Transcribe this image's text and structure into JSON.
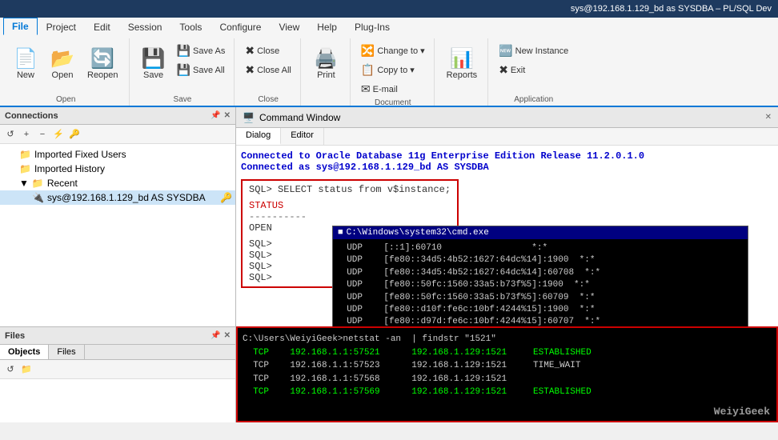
{
  "titleBar": {
    "text": "sys@192.168.1.129_bd as SYSDBA – PL/SQL Dev"
  },
  "menu": {
    "items": [
      "File",
      "Project",
      "Edit",
      "Session",
      "Tools",
      "Configure",
      "View",
      "Help",
      "Plug-Ins"
    ]
  },
  "ribbon": {
    "groups": [
      {
        "label": "Open",
        "buttons": [
          {
            "id": "new",
            "label": "New",
            "icon": "📄"
          },
          {
            "id": "open",
            "label": "Open",
            "icon": "📂"
          },
          {
            "id": "reopen",
            "label": "Reopen",
            "icon": "🔄"
          }
        ]
      },
      {
        "label": "Save",
        "buttons": [
          {
            "id": "save",
            "label": "Save",
            "icon": "💾"
          },
          {
            "id": "save-as",
            "label": "Save As",
            "icon": "💾"
          },
          {
            "id": "save-all",
            "label": "Save All",
            "icon": "💾"
          }
        ]
      },
      {
        "label": "Close",
        "buttons": [
          {
            "id": "close",
            "label": "Close",
            "icon": "✖"
          },
          {
            "id": "close-all",
            "label": "Close All",
            "icon": "✖"
          }
        ]
      },
      {
        "label": "",
        "buttons": [
          {
            "id": "print",
            "label": "Print",
            "icon": "🖨️"
          }
        ]
      },
      {
        "label": "Document",
        "buttons": [
          {
            "id": "change-to",
            "label": "Change to ▾",
            "icon": "🔀"
          },
          {
            "id": "copy-to",
            "label": "Copy to ▾",
            "icon": "📋"
          },
          {
            "id": "email",
            "label": "E-mail",
            "icon": "✉"
          }
        ]
      },
      {
        "label": "",
        "buttons": [
          {
            "id": "reports",
            "label": "Reports",
            "icon": "📊"
          }
        ]
      },
      {
        "label": "Application",
        "buttons": [
          {
            "id": "new-instance",
            "label": "New Instance",
            "icon": "🆕"
          },
          {
            "id": "exit",
            "label": "Exit",
            "icon": "🚪"
          }
        ]
      }
    ]
  },
  "tabRibbon": {
    "activeTab": "File",
    "tabs": [
      "File",
      "Project",
      "Edit",
      "Session",
      "Tools",
      "Configure",
      "View",
      "Help",
      "Plug-Ins"
    ]
  },
  "connections": {
    "title": "Connections",
    "tree": [
      {
        "label": "Imported Fixed Users",
        "level": 1,
        "icon": "📁"
      },
      {
        "label": "Imported History",
        "level": 1,
        "icon": "📁"
      },
      {
        "label": "Recent",
        "level": 1,
        "icon": "📁",
        "expanded": true
      },
      {
        "label": "sys@192.168.1.129_bd AS SYSDBA",
        "level": 2,
        "icon": "🔌",
        "selected": true
      }
    ]
  },
  "bottomPanel": {
    "tabs": [
      "Objects",
      "Files"
    ],
    "activeTab": "Objects"
  },
  "commandWindow": {
    "title": "Command Window",
    "tabs": [
      "Dialog",
      "Editor"
    ],
    "activeTab": "Dialog",
    "connectedLine1": "Connected to Oracle Database 11g Enterprise Edition Release 11.2.0.1.0",
    "connectedLine2": "Connected as sys@192.168.1.129_bd AS SYSDBA",
    "sqlQuery": "SQL> SELECT status from v$instance;",
    "statusLabel": "STATUS",
    "dashes": "----------",
    "openValue": "OPEN",
    "sqlPrompts": [
      "SQL>",
      "SQL>",
      "SQL>",
      "SQL>"
    ]
  },
  "cmdWindow": {
    "title": "C:\\Windows\\system32\\cmd.exe",
    "lines": [
      "  UDP    [::1]:60710                 *:*",
      "  UDP    [fe80::34d5:4b52:1627:64dc%14]:1900  *:*",
      "  UDP    [fe80::34d5:4b52:1627:64dc%14]:60708  *:*",
      "  UDP    [fe80::50fc:1560:33a5:b73f%5]:1900  *:*",
      "  UDP    [fe80::50fc:1560:33a5:b73f%5]:60709  *:*",
      "  UDP    [fe80::d10f:fe6c:10bf:4244%15]:1900  *:*",
      "  UDP    [fe80::d97d:fe6c:10bf:4244%15]:60707  *:*"
    ]
  },
  "netstat": {
    "command": "C:\\Users\\WeiyiGeek>netstat -an  | findstr \"1521\"",
    "lines": [
      "  TCP    192.168.1.1:57521      192.168.1.129:1521     ESTABLISHED",
      "  TCP    192.168.1.1:57523      192.168.1.129:1521     TIME_WAIT",
      "  TCP    192.168.1.1:57568      192.168.1.129:1521",
      "  TCP    192.168.1.1:57569      192.168.1.129:1521     ESTABLISHED"
    ]
  },
  "watermark": "WeiyiGeek"
}
